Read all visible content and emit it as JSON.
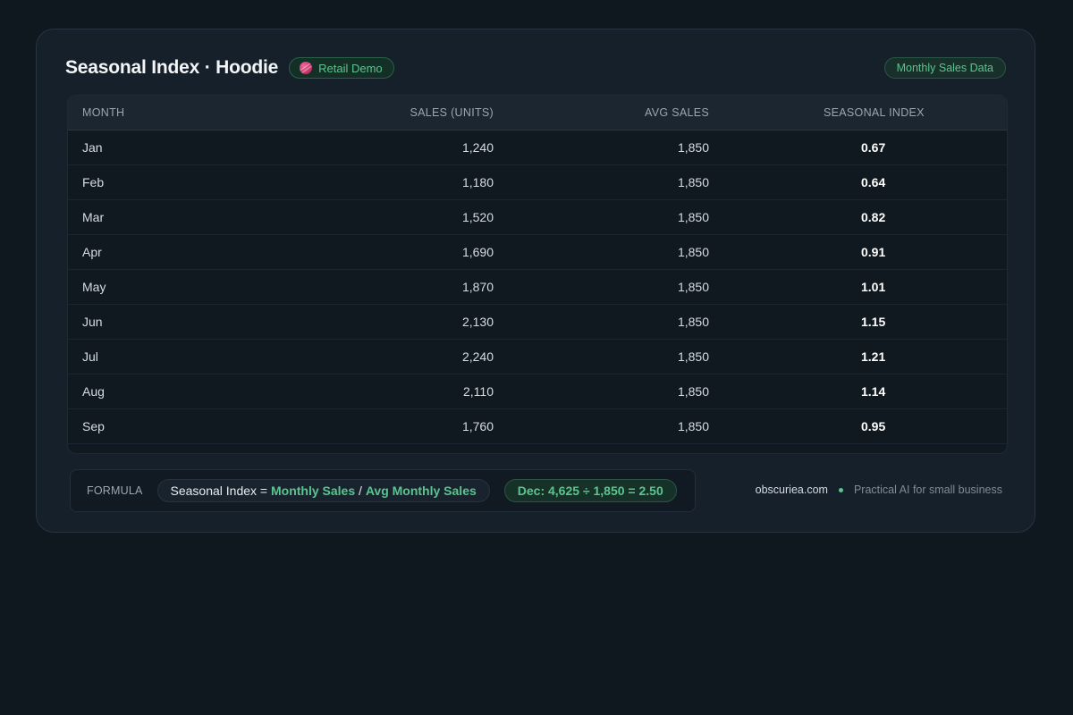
{
  "header": {
    "title": "Seasonal Index · Hoodie",
    "badge": "Retail Demo",
    "badge_icon": "yarn-ball-icon",
    "right_badge": "Monthly Sales Data"
  },
  "table": {
    "columns": [
      "MONTH",
      "SALES (UNITS)",
      "AVG SALES",
      "SEASONAL INDEX"
    ],
    "rows": [
      {
        "month": "Jan",
        "sales": "1,240",
        "avg": "1,850",
        "index": "0.67"
      },
      {
        "month": "Feb",
        "sales": "1,180",
        "avg": "1,850",
        "index": "0.64"
      },
      {
        "month": "Mar",
        "sales": "1,520",
        "avg": "1,850",
        "index": "0.82"
      },
      {
        "month": "Apr",
        "sales": "1,690",
        "avg": "1,850",
        "index": "0.91"
      },
      {
        "month": "May",
        "sales": "1,870",
        "avg": "1,850",
        "index": "1.01"
      },
      {
        "month": "Jun",
        "sales": "2,130",
        "avg": "1,850",
        "index": "1.15"
      },
      {
        "month": "Jul",
        "sales": "2,240",
        "avg": "1,850",
        "index": "1.21"
      },
      {
        "month": "Aug",
        "sales": "2,110",
        "avg": "1,850",
        "index": "1.14"
      },
      {
        "month": "Sep",
        "sales": "1,760",
        "avg": "1,850",
        "index": "0.95"
      }
    ]
  },
  "formula": {
    "label": "FORMULA",
    "prefix": "Seasonal Index = ",
    "numerator": "Monthly Sales",
    "divider": " / ",
    "denominator": "Avg Monthly Sales",
    "example": "Dec: 4,625 ÷ 1,850 = 2.50"
  },
  "brand": {
    "site": "obscuriea.com",
    "tagline": "Practical AI for small business"
  },
  "colors": {
    "accent": "#5cc48f",
    "background": "#0f171f",
    "card": "#16202b"
  }
}
